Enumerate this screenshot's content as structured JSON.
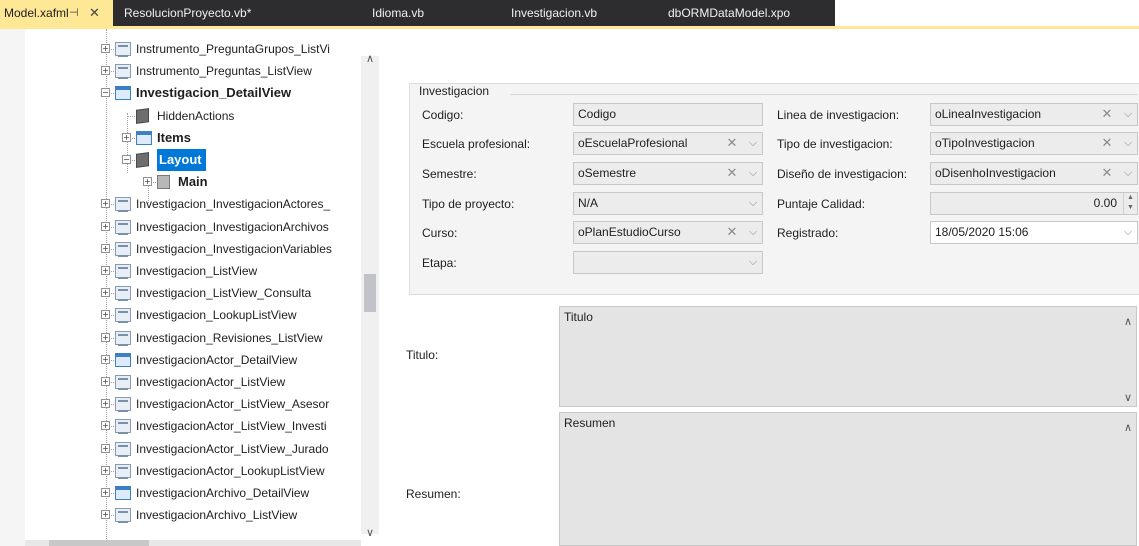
{
  "tabs": [
    {
      "label": "Model.xafml",
      "pin": "⊣",
      "close": "✕"
    },
    {
      "label": "ResolucionProyecto.vb*"
    },
    {
      "label": "Idioma.vb"
    },
    {
      "label": "Investigacion.vb"
    },
    {
      "label": "dbORMDataModel.xpo"
    }
  ],
  "tree": {
    "items": [
      {
        "label": "Instrumento_PreguntaGrupos_ListVi",
        "icon": "list-view-icon",
        "bold": false,
        "level": 1,
        "exp": "+"
      },
      {
        "label": "Instrumento_Preguntas_ListView",
        "icon": "list-view-icon",
        "bold": false,
        "level": 1,
        "exp": "+"
      },
      {
        "label": "Investigacion_DetailView",
        "icon": "detail-view-icon",
        "bold": true,
        "level": 1,
        "exp": "−"
      },
      {
        "label": "HiddenActions",
        "icon": "node-icon",
        "bold": false,
        "level": 2,
        "exp": ""
      },
      {
        "label": "Items",
        "icon": "items-icon",
        "bold": true,
        "level": 2,
        "exp": "+"
      },
      {
        "label": "Layout",
        "icon": "layout-icon",
        "bold": true,
        "level": 2,
        "exp": "−",
        "selected": true
      },
      {
        "label": "Main",
        "icon": "group-icon",
        "bold": true,
        "level": 3,
        "exp": "+"
      },
      {
        "label": "Investigacion_InvestigacionActores_",
        "icon": "list-view-icon",
        "bold": false,
        "level": 1,
        "exp": "+"
      },
      {
        "label": "Investigacion_InvestigacionArchivos",
        "icon": "list-view-icon",
        "bold": false,
        "level": 1,
        "exp": "+"
      },
      {
        "label": "Investigacion_InvestigacionVariables",
        "icon": "list-view-icon",
        "bold": false,
        "level": 1,
        "exp": "+"
      },
      {
        "label": "Investigacion_ListView",
        "icon": "list-view-icon",
        "bold": false,
        "level": 1,
        "exp": "+"
      },
      {
        "label": "Investigacion_ListView_Consulta",
        "icon": "list-view-icon",
        "bold": false,
        "level": 1,
        "exp": "+"
      },
      {
        "label": "Investigacion_LookupListView",
        "icon": "list-view-icon",
        "bold": false,
        "level": 1,
        "exp": "+"
      },
      {
        "label": "Investigacion_Revisiones_ListView",
        "icon": "list-view-icon",
        "bold": false,
        "level": 1,
        "exp": "+"
      },
      {
        "label": "InvestigacionActor_DetailView",
        "icon": "detail-view-icon",
        "bold": false,
        "level": 1,
        "exp": "+"
      },
      {
        "label": "InvestigacionActor_ListView",
        "icon": "list-view-icon",
        "bold": false,
        "level": 1,
        "exp": "+"
      },
      {
        "label": "InvestigacionActor_ListView_Asesor",
        "icon": "list-view-icon",
        "bold": false,
        "level": 1,
        "exp": "+"
      },
      {
        "label": "InvestigacionActor_ListView_Investi",
        "icon": "list-view-icon",
        "bold": false,
        "level": 1,
        "exp": "+"
      },
      {
        "label": "InvestigacionActor_ListView_Jurado",
        "icon": "list-view-icon",
        "bold": false,
        "level": 1,
        "exp": "+"
      },
      {
        "label": "InvestigacionActor_LookupListView",
        "icon": "list-view-icon",
        "bold": false,
        "level": 1,
        "exp": "+"
      },
      {
        "label": "InvestigacionArchivo_DetailView",
        "icon": "detail-view-icon",
        "bold": false,
        "level": 1,
        "exp": "+"
      },
      {
        "label": "InvestigacionArchivo_ListView",
        "icon": "list-view-icon",
        "bold": false,
        "level": 1,
        "exp": "+"
      }
    ]
  },
  "form": {
    "group_title": "Investigacion",
    "left": [
      {
        "label": "Codigo:",
        "value": "Codigo",
        "clear": false,
        "dropdown": false
      },
      {
        "label": "Escuela profesional:",
        "value": "oEscuelaProfesional",
        "clear": true,
        "dropdown": true
      },
      {
        "label": "Semestre:",
        "value": "oSemestre",
        "clear": true,
        "dropdown": true
      },
      {
        "label": "Tipo de proyecto:",
        "value": "N/A",
        "clear": false,
        "dropdown": true
      },
      {
        "label": "Curso:",
        "value": "oPlanEstudioCurso",
        "clear": true,
        "dropdown": true
      },
      {
        "label": "Etapa:",
        "value": "",
        "clear": false,
        "dropdown": true
      }
    ],
    "right": [
      {
        "label": "Linea de investigacion:",
        "value": "oLineaInvestigacion",
        "clear": true,
        "dropdown": true
      },
      {
        "label": "Tipo de investigacion:",
        "value": "oTipoInvestigacion",
        "clear": true,
        "dropdown": true
      },
      {
        "label": "Diseño de investigacion:",
        "value": "oDisenhoInvestigacion",
        "clear": true,
        "dropdown": true
      },
      {
        "label": "Puntaje Calidad:",
        "value": "0.00",
        "spin": true
      },
      {
        "label": "Registrado:",
        "value": "18/05/2020 15:06",
        "dropdown": true,
        "white": true
      }
    ],
    "titulo": {
      "label": "Titulo:",
      "value": "Titulo"
    },
    "resumen": {
      "label": "Resumen:",
      "value": "Resumen"
    }
  },
  "glyphs": {
    "clear": "✕",
    "dropdown": "⌵",
    "spin_up": "▲",
    "spin_down": "▼",
    "scroll_up": "∧",
    "scroll_down": "∨"
  }
}
